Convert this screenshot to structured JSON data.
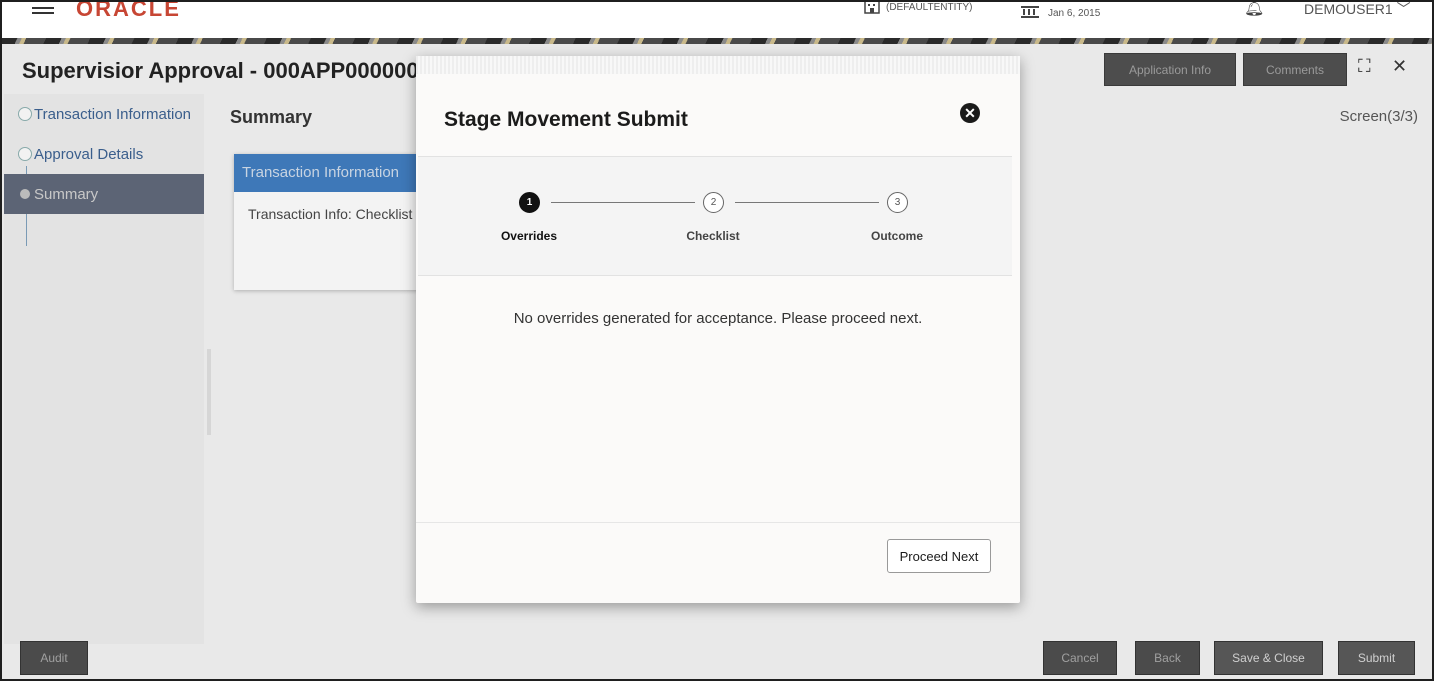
{
  "header": {
    "logo": "ORACLE",
    "entity": "(DEFAULTENTITY)",
    "date": "Jan 6, 2015",
    "user": "DEMOUSER1"
  },
  "page": {
    "title": "Supervisior Approval - 000APP000000",
    "application_info_label": "Application Info",
    "comments_label": "Comments",
    "screen_count": "Screen(3/3)",
    "summary_title": "Summary"
  },
  "sidebar": {
    "items": [
      {
        "label": "Transaction Information"
      },
      {
        "label": "Approval Details"
      },
      {
        "label": "Summary"
      }
    ]
  },
  "card": {
    "header": "Transaction Information",
    "body": "Transaction Info: Checklist"
  },
  "footer": {
    "audit": "Audit",
    "cancel": "Cancel",
    "back": "Back",
    "save_close": "Save & Close",
    "submit": "Submit"
  },
  "modal": {
    "title": "Stage Movement Submit",
    "steps": [
      {
        "num": "1",
        "label": "Overrides",
        "state": "current"
      },
      {
        "num": "2",
        "label": "Checklist",
        "state": "pending"
      },
      {
        "num": "3",
        "label": "Outcome",
        "state": "pending"
      }
    ],
    "message": "No overrides generated for acceptance. Please proceed next.",
    "proceed_label": "Proceed Next"
  },
  "colors": {
    "brand": "#c74634",
    "card_header": "#3e78b8",
    "sidebar_active": "#5c6475"
  }
}
